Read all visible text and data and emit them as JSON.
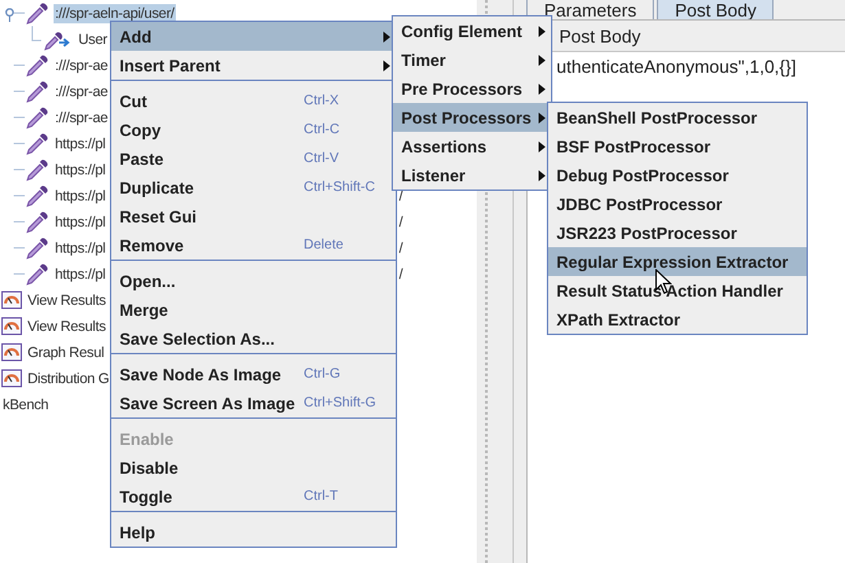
{
  "tree": {
    "items": [
      {
        "kind": "sampler",
        "text": ":///spr-aeln-api/user/",
        "selected": true,
        "expanded": true,
        "children": [
          {
            "kind": "modifier",
            "text": "User",
            "selected": false
          }
        ]
      },
      {
        "kind": "sampler",
        "text": ":///spr-ae",
        "selected": false
      },
      {
        "kind": "sampler",
        "text": ":///spr-ae",
        "selected": false
      },
      {
        "kind": "sampler",
        "text": ":///spr-ae",
        "selected": false
      },
      {
        "kind": "sampler",
        "text": "https://pl",
        "selected": false
      },
      {
        "kind": "sampler",
        "text": "https://pl",
        "selected": false
      },
      {
        "kind": "sampler",
        "text": "https://pl",
        "selected": false,
        "tail": "/"
      },
      {
        "kind": "sampler",
        "text": "https://pl",
        "selected": false,
        "tail": "/"
      },
      {
        "kind": "sampler",
        "text": "https://pl",
        "selected": false,
        "tail": "/"
      },
      {
        "kind": "sampler",
        "text": "https://pl",
        "selected": false,
        "tail": "/"
      },
      {
        "kind": "listener",
        "text": "View Results",
        "selected": false
      },
      {
        "kind": "listener",
        "text": "View Results",
        "selected": false
      },
      {
        "kind": "listener",
        "text": "Graph Resul",
        "selected": false
      },
      {
        "kind": "listener",
        "text": "Distribution G",
        "selected": false
      },
      {
        "kind": "workbench",
        "text": "kBench",
        "selected": false
      }
    ]
  },
  "tabs": [
    {
      "label": "Parameters",
      "selected": false
    },
    {
      "label": "Post Body",
      "selected": true
    }
  ],
  "post_body": {
    "header": "Post Body",
    "text": "uthenticateAnonymous\",1,0,{}]"
  },
  "context_menu": {
    "items": [
      {
        "kind": "item",
        "label": "Add",
        "submenu": true,
        "selected": true,
        "disabled": false
      },
      {
        "kind": "item",
        "label": "Insert Parent",
        "submenu": true,
        "selected": false,
        "disabled": false
      },
      {
        "kind": "separator"
      },
      {
        "kind": "item",
        "label": "Cut",
        "shortcut": "Ctrl-X",
        "selected": false,
        "disabled": false
      },
      {
        "kind": "item",
        "label": "Copy",
        "shortcut": "Ctrl-C",
        "selected": false,
        "disabled": false
      },
      {
        "kind": "item",
        "label": "Paste",
        "shortcut": "Ctrl-V",
        "selected": false,
        "disabled": false
      },
      {
        "kind": "item",
        "label": "Duplicate",
        "shortcut": "Ctrl+Shift-C",
        "selected": false,
        "disabled": false
      },
      {
        "kind": "item",
        "label": "Reset Gui",
        "selected": false,
        "disabled": false
      },
      {
        "kind": "item",
        "label": "Remove",
        "shortcut": "Delete",
        "selected": false,
        "disabled": false
      },
      {
        "kind": "separator"
      },
      {
        "kind": "item",
        "label": "Open...",
        "selected": false,
        "disabled": false
      },
      {
        "kind": "item",
        "label": "Merge",
        "selected": false,
        "disabled": false
      },
      {
        "kind": "item",
        "label": "Save Selection As...",
        "selected": false,
        "disabled": false
      },
      {
        "kind": "separator"
      },
      {
        "kind": "item",
        "label": "Save Node As Image",
        "shortcut": "Ctrl-G",
        "selected": false,
        "disabled": false
      },
      {
        "kind": "item",
        "label": "Save Screen As Image",
        "shortcut": "Ctrl+Shift-G",
        "selected": false,
        "disabled": false
      },
      {
        "kind": "separator"
      },
      {
        "kind": "item",
        "label": "Enable",
        "selected": false,
        "disabled": true
      },
      {
        "kind": "item",
        "label": "Disable",
        "selected": false,
        "disabled": false
      },
      {
        "kind": "item",
        "label": "Toggle",
        "shortcut": "Ctrl-T",
        "selected": false,
        "disabled": false
      },
      {
        "kind": "separator"
      },
      {
        "kind": "item",
        "label": "Help",
        "selected": false,
        "disabled": false
      }
    ]
  },
  "add_submenu": {
    "items": [
      {
        "label": "Config Element",
        "submenu": true,
        "selected": false
      },
      {
        "label": "Timer",
        "submenu": true,
        "selected": false
      },
      {
        "label": "Pre Processors",
        "submenu": true,
        "selected": false
      },
      {
        "label": "Post Processors",
        "submenu": true,
        "selected": true
      },
      {
        "label": "Assertions",
        "submenu": true,
        "selected": false
      },
      {
        "label": "Listener",
        "submenu": true,
        "selected": false
      }
    ]
  },
  "post_processors_submenu": {
    "items": [
      {
        "label": "BeanShell PostProcessor",
        "selected": false
      },
      {
        "label": "BSF PostProcessor",
        "selected": false
      },
      {
        "label": "Debug PostProcessor",
        "selected": false
      },
      {
        "label": "JDBC PostProcessor",
        "selected": false
      },
      {
        "label": "JSR223 PostProcessor",
        "selected": false
      },
      {
        "label": "Regular Expression Extractor",
        "selected": true
      },
      {
        "label": "Result Status Action Handler",
        "selected": false
      },
      {
        "label": "XPath Extractor",
        "selected": false
      }
    ]
  }
}
